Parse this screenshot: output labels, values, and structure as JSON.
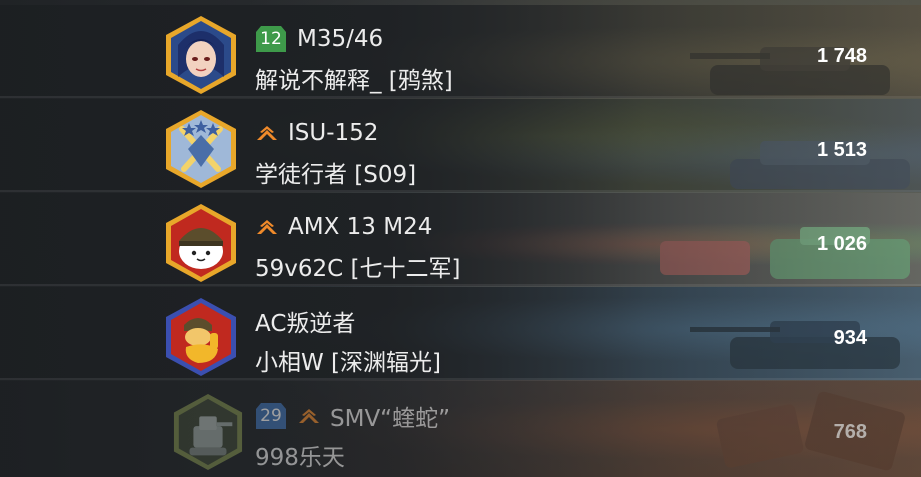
{
  "colors": {
    "tier_green": "#3e9a4a",
    "tier_blue": "#3d6fb2",
    "rank_orange": "#f08a2a",
    "text": "#ececec",
    "score": "#ffffff"
  },
  "players": [
    {
      "tier": "12",
      "tier_color": "#3e9a4a",
      "rank_icon": "",
      "vehicle": "M35/46",
      "nickname": "解说不解释_ [鸦煞]",
      "score": "1 748",
      "avatar_icon": "anime-girl-avatar-icon"
    },
    {
      "tier": "",
      "rank_icon": "chevron-rank-icon",
      "vehicle": "ISU-152",
      "nickname": "学徒行者 [S09]",
      "score": "1 513",
      "avatar_icon": "crossed-swords-avatar-icon"
    },
    {
      "tier": "",
      "rank_icon": "chevron-rank-icon",
      "vehicle": "AMX 13 M24",
      "nickname": "59v62C [七十二军]",
      "score": "1 026",
      "avatar_icon": "helmet-blob-avatar-icon"
    },
    {
      "tier": "",
      "rank_icon": "",
      "vehicle": "AC叛逆者",
      "nickname": "小相W [深渊辐光]",
      "score": "934",
      "avatar_icon": "thumbs-up-soldier-avatar-icon"
    },
    {
      "tier": "29",
      "tier_color": "#3d6fb2",
      "rank_icon": "chevron-rank-icon",
      "vehicle": "SMV“蝰蛇”",
      "nickname": "998乐天",
      "score": "768",
      "avatar_icon": "tank-turret-avatar-icon"
    }
  ]
}
